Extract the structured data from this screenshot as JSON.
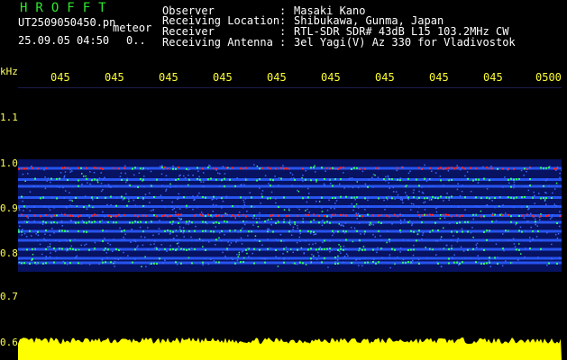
{
  "header": {
    "title": "HROFFT",
    "file_name": "UT2509050450.pn",
    "meteor_label": "meteor",
    "datetime": "25.09.05 04:50",
    "count": "0..",
    "observer_label": "Observer",
    "observer_value": "Masaki Kano",
    "location_label": "Receiving Location",
    "location_value": "Shibukawa, Gunma, Japan",
    "receiver_label": "Receiver",
    "receiver_value": "RTL-SDR SDR# 43dB L15 103.2MHz CW",
    "antenna_label": "Receiving Antenna",
    "antenna_value": "3el Yagi(V) Az 330 for Vladivostok",
    "colon": ":"
  },
  "axes": {
    "y_unit": "kHz",
    "x_ticks": [
      "045",
      "045",
      "045",
      "045",
      "045",
      "045",
      "045",
      "045",
      "045",
      "0500"
    ],
    "y_ticks": [
      "1.1",
      "1.0",
      "0.9",
      "0.8",
      "0.7",
      "0.6"
    ]
  },
  "colors": {
    "background": "#000000",
    "title": "#2ee82e",
    "tick_label": "#ffff33",
    "meter_bar": "#ffff00",
    "band_strong": "#ff2a2a",
    "band_mid": "#33ff66",
    "band_weak": "#2a5cff",
    "noise": "#0a1a8a"
  },
  "spectrogram": {
    "freq_min_khz": 0.6,
    "freq_max_khz": 1.2,
    "bands": [
      {
        "freq_khz": 0.99,
        "level": "strong"
      },
      {
        "freq_khz": 0.965,
        "level": "mid"
      },
      {
        "freq_khz": 0.95,
        "level": "weak"
      },
      {
        "freq_khz": 0.925,
        "level": "mid"
      },
      {
        "freq_khz": 0.905,
        "level": "weak"
      },
      {
        "freq_khz": 0.885,
        "level": "strong"
      },
      {
        "freq_khz": 0.87,
        "level": "mid"
      },
      {
        "freq_khz": 0.85,
        "level": "mid"
      },
      {
        "freq_khz": 0.83,
        "level": "weak"
      },
      {
        "freq_khz": 0.81,
        "level": "mid"
      },
      {
        "freq_khz": 0.79,
        "level": "weak"
      },
      {
        "freq_khz": 0.78,
        "level": "mid"
      }
    ]
  }
}
